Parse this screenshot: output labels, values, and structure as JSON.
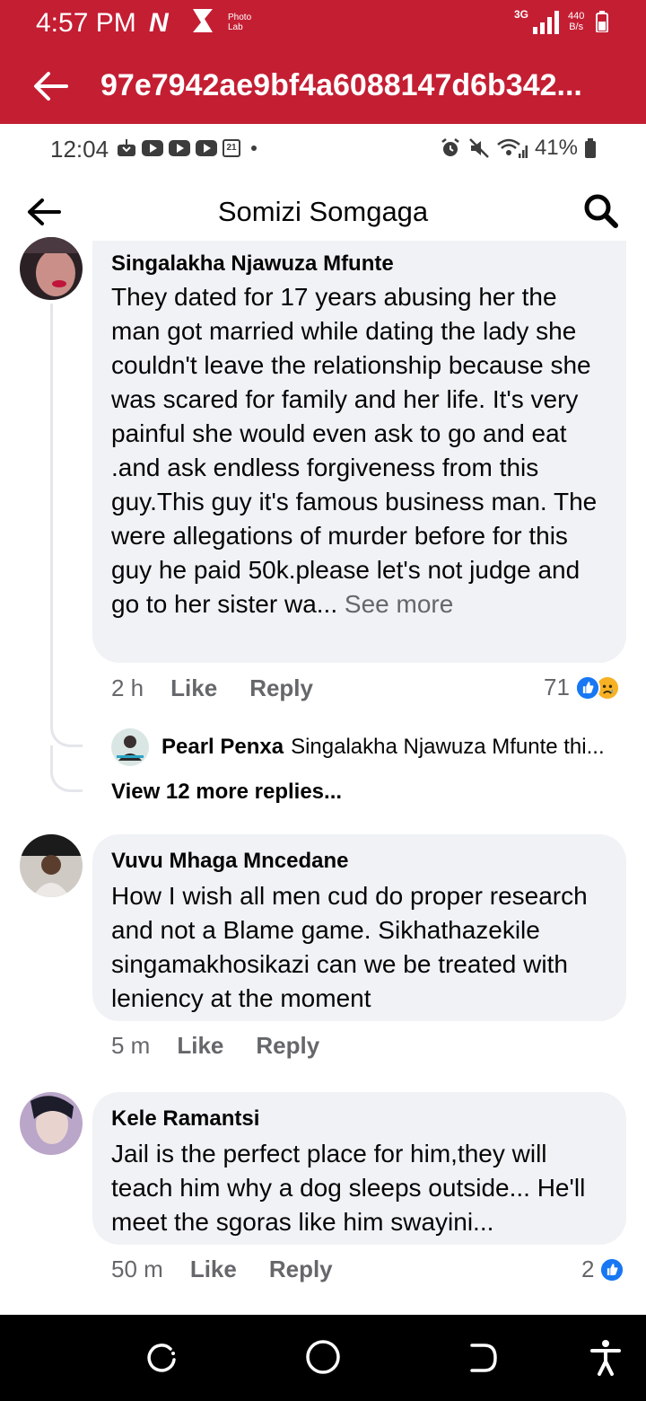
{
  "outer_status": {
    "time": "4:57 PM",
    "app_letter": "N",
    "photolab_line1": "Photo",
    "photolab_line2": "Lab",
    "network": "3G",
    "speed_value": "440",
    "speed_unit": "B/s"
  },
  "outer_title": {
    "text": "97e7942ae9bf4a6088147d6b342..."
  },
  "inner_status": {
    "time": "12:04",
    "calendar_day": "21",
    "battery": "41%"
  },
  "header": {
    "title": "Somizi Somgaga"
  },
  "comments": [
    {
      "author": "Singalakha Njawuza Mfunte",
      "text": "They dated for 17 years abusing her the man got married while dating the lady she couldn't leave the relationship because she was scared for family and her life. It's very painful she would even ask to go and eat .and ask endless forgiveness from this guy.This guy it's famous business man. The were allegations of murder before for this guy he paid 50k.please let's not judge and go to her sister wa...",
      "see_more": "See more",
      "time": "2 h",
      "like": "Like",
      "reply": "Reply",
      "reaction_count": "71",
      "reply_preview": {
        "author": "Pearl Penxa",
        "text": "Singalakha Njawuza Mfunte thi..."
      },
      "view_more": "View 12 more replies..."
    },
    {
      "author": "Vuvu Mhaga Mncedane",
      "text": "How I wish all men cud do proper research and not a Blame game. Sikhathazekile singamakhosikazi can we be treated with leniency at the moment",
      "time": "5 m",
      "like": "Like",
      "reply": "Reply"
    },
    {
      "author": "Kele Ramantsi",
      "text": "Jail is the perfect place for him,they will teach him why a dog sleeps outside... He'll meet the sgoras like him swayini...",
      "time": "50 m",
      "like": "Like",
      "reply": "Reply",
      "reaction_count": "2"
    }
  ],
  "colors": {
    "outer_bar": "#c41e33",
    "bubble": "#f0f2f5",
    "meta": "#65676b",
    "like_blue": "#1877f2"
  }
}
